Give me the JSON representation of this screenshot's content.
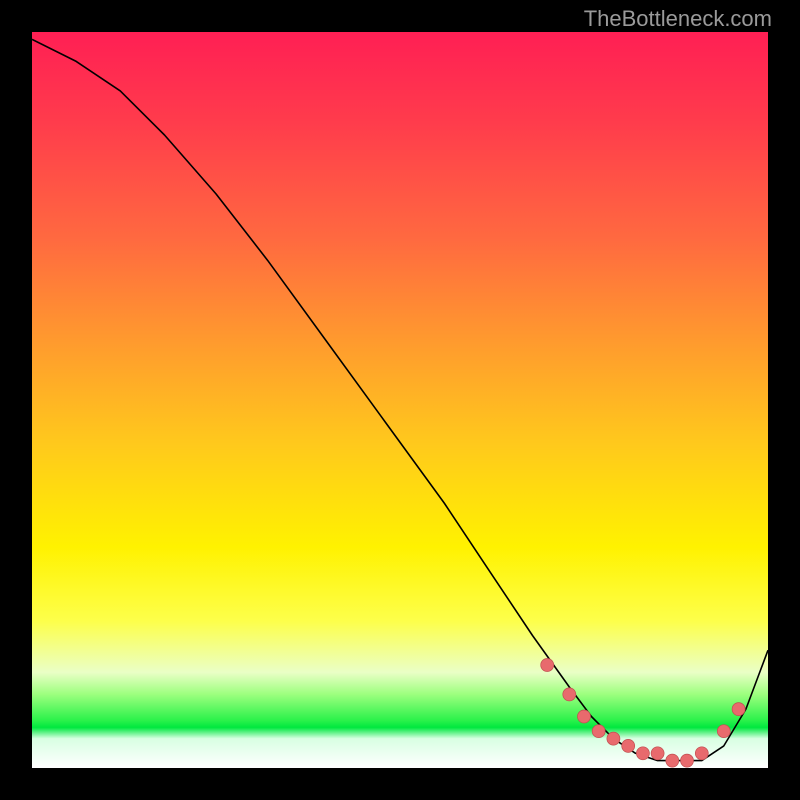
{
  "attribution": "TheBottleneck.com",
  "chart_data": {
    "type": "line",
    "title": "",
    "xlabel": "",
    "ylabel": "",
    "xlim": [
      0,
      100
    ],
    "ylim": [
      0,
      100
    ],
    "grid": false,
    "legend": false,
    "series": [
      {
        "name": "bottleneck-curve",
        "x": [
          0,
          6,
          12,
          18,
          25,
          32,
          40,
          48,
          56,
          62,
          68,
          73,
          76,
          79,
          82,
          85,
          88,
          91,
          94,
          97,
          100
        ],
        "values": [
          99,
          96,
          92,
          86,
          78,
          69,
          58,
          47,
          36,
          27,
          18,
          11,
          7,
          4,
          2,
          1,
          1,
          1,
          3,
          8,
          16
        ]
      }
    ],
    "markers": {
      "name": "highlight-points",
      "x": [
        70,
        73,
        75,
        77,
        79,
        81,
        83,
        85,
        87,
        89,
        91,
        94,
        96
      ],
      "values": [
        14,
        10,
        7,
        5,
        4,
        3,
        2,
        2,
        1,
        1,
        2,
        5,
        8
      ]
    },
    "color_scale_note": "vertical gradient: red (high) to green (low)"
  }
}
